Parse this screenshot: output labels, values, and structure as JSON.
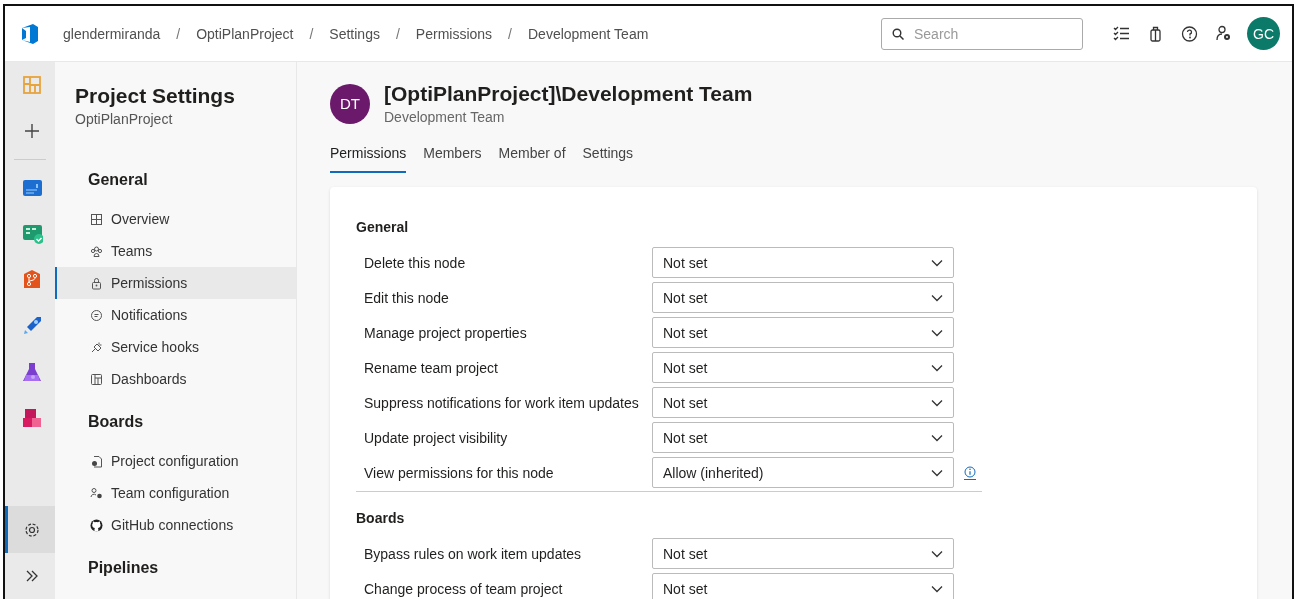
{
  "breadcrumbs": [
    {
      "kind": "link",
      "text": "glendermiranda"
    },
    {
      "kind": "separator",
      "text": "/"
    },
    {
      "kind": "link",
      "text": "OptiPlanProject"
    },
    {
      "kind": "separator",
      "text": "/"
    },
    {
      "kind": "link",
      "text": "Settings"
    },
    {
      "kind": "separator",
      "text": "/"
    },
    {
      "kind": "link",
      "text": "Permissions"
    },
    {
      "kind": "separator",
      "text": "/"
    },
    {
      "kind": "link",
      "text": "Development Team"
    }
  ],
  "search": {
    "placeholder": "Search"
  },
  "user": {
    "initials": "GC"
  },
  "rail": {
    "items": [
      {
        "selected": false
      },
      {
        "selected": false
      },
      {
        "selected": false
      },
      {
        "selected": false
      },
      {
        "selected": false
      },
      {
        "selected": false
      },
      {
        "selected": false
      },
      {
        "selected": false
      },
      {
        "selected": true
      },
      {
        "selected": false
      }
    ]
  },
  "settings_nav": {
    "title": "Project Settings",
    "subtitle": "OptiPlanProject",
    "groups": [
      {
        "title": "General",
        "items": [
          {
            "label": "Overview",
            "selected": false
          },
          {
            "label": "Teams",
            "selected": false
          },
          {
            "label": "Permissions",
            "selected": true
          },
          {
            "label": "Notifications",
            "selected": false
          },
          {
            "label": "Service hooks",
            "selected": false
          },
          {
            "label": "Dashboards",
            "selected": false
          }
        ]
      },
      {
        "title": "Boards",
        "items": [
          {
            "label": "Project configuration",
            "selected": false
          },
          {
            "label": "Team configuration",
            "selected": false
          },
          {
            "label": "GitHub connections",
            "selected": false
          }
        ]
      },
      {
        "title": "Pipelines"
      }
    ]
  },
  "group": {
    "initials": "DT",
    "title": "[OptiPlanProject]\\Development Team",
    "subtitle": "Development Team"
  },
  "tabs": [
    {
      "label": "Permissions",
      "selected": true
    },
    {
      "label": "Members",
      "selected": false
    },
    {
      "label": "Member of",
      "selected": false
    },
    {
      "label": "Settings",
      "selected": false
    }
  ],
  "sections": [
    {
      "title": "General",
      "rows": [
        {
          "name": "Delete this node",
          "value": "Not set",
          "info": false
        },
        {
          "name": "Edit this node",
          "value": "Not set",
          "info": false
        },
        {
          "name": "Manage project properties",
          "value": "Not set",
          "info": false
        },
        {
          "name": "Rename team project",
          "value": "Not set",
          "info": false
        },
        {
          "name": "Suppress notifications for work item updates",
          "value": "Not set",
          "info": false
        },
        {
          "name": "Update project visibility",
          "value": "Not set",
          "info": false
        },
        {
          "name": "View permissions for this node",
          "value": "Allow (inherited)",
          "info": true
        }
      ]
    },
    {
      "title": "Boards",
      "rows": [
        {
          "name": "Bypass rules on work item updates",
          "value": "Not set",
          "info": false
        },
        {
          "name": "Change process of team project",
          "value": "Not set",
          "info": false
        }
      ]
    }
  ]
}
